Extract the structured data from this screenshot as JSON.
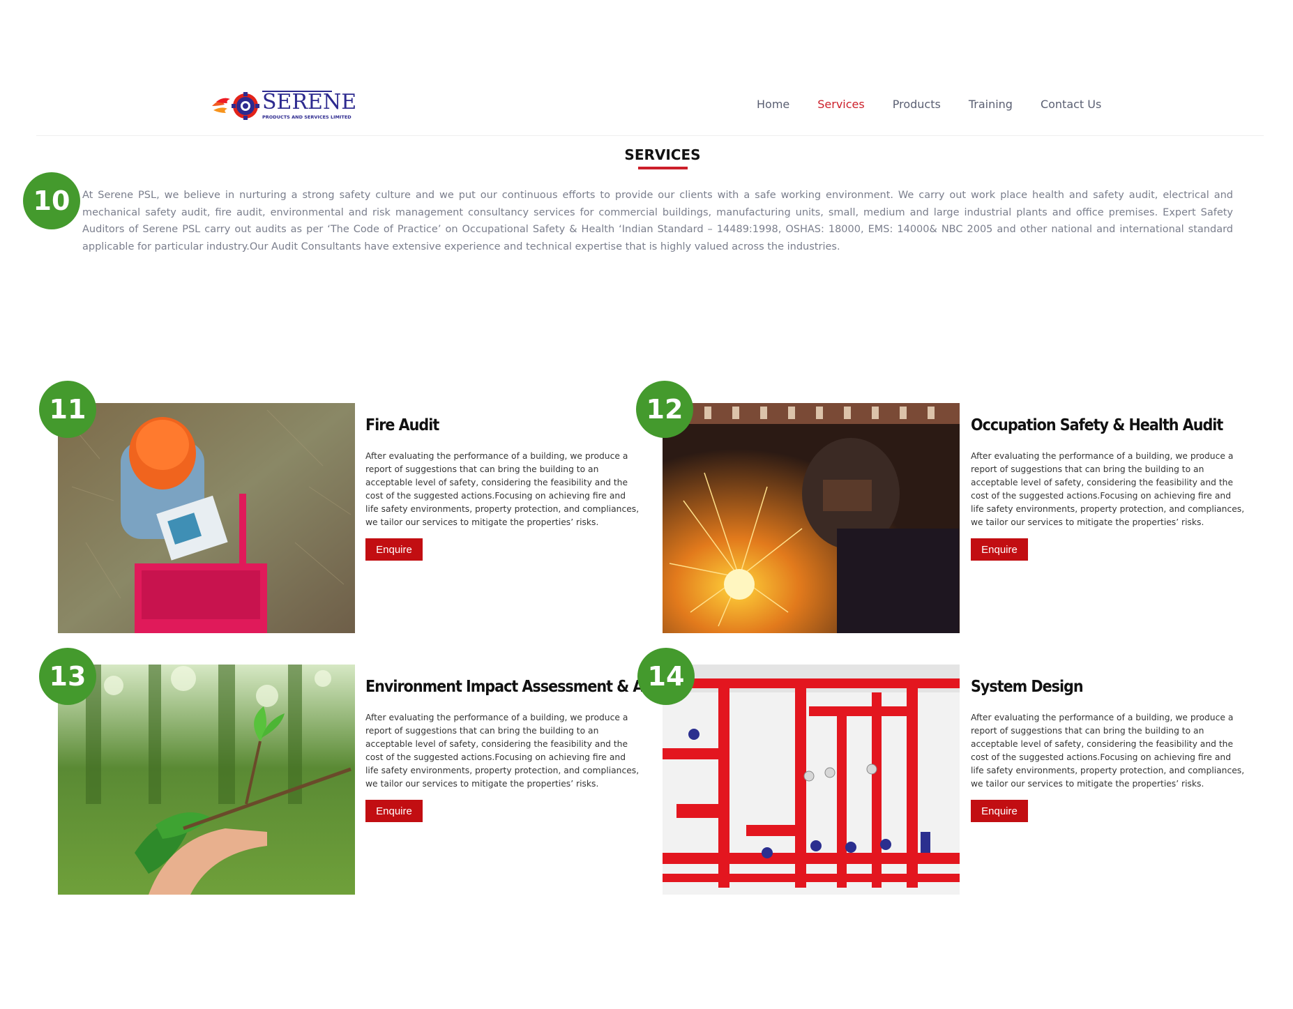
{
  "brand": {
    "name": "SERENE",
    "tagline": "PRODUCTS AND SERVICES LIMITED"
  },
  "nav": {
    "items": [
      {
        "label": "Home",
        "active": false
      },
      {
        "label": "Services",
        "active": true
      },
      {
        "label": "Products",
        "active": false
      },
      {
        "label": "Training",
        "active": false
      },
      {
        "label": "Contact Us",
        "active": false
      }
    ]
  },
  "section": {
    "title": "SERVICES",
    "badge": "10",
    "intro": "At Serene PSL, we believe in nurturing a strong safety culture and we put our continuous efforts to provide our clients with a safe working environment. We carry out work place health and safety audit, electrical and mechanical safety audit, fire audit, environmental and risk management consultancy services for commercial buildings, manufacturing units, small, medium and large industrial plants and office premises. Expert Safety Auditors of Serene PSL carry out audits as per ‘The Code of Practice’ on Occupational Safety & Health ‘Indian Standard – 14489:1998, OSHAS: 18000, EMS: 14000& NBC 2005 and other national and international standard applicable for particular industry.Our Audit Consultants have extensive experience and technical expertise that is highly valued across the industries."
  },
  "services": [
    {
      "badge": "11",
      "title": "Fire Audit",
      "description": "After evaluating the performance of a building, we produce a report of suggestions that can bring the building to an acceptable level of safety, considering the feasibility and the cost of the suggested actions.Focusing on achieving fire and life safety environments, property protection, and compliances, we tailor our services to mitigate the properties’ risks.",
      "button": "Enquire"
    },
    {
      "badge": "12",
      "title": "Occupation Safety & Health Audit",
      "description": "After evaluating the performance of a building, we produce a report of suggestions that can bring the building to an acceptable level of safety, considering the feasibility and the cost of the suggested actions.Focusing on achieving fire and life safety environments, property protection, and compliances, we tailor our services to mitigate the properties’ risks.",
      "button": "Enquire"
    },
    {
      "badge": "13",
      "title": "Environment Impact Assessment & Audit",
      "description": "After evaluating the performance of a building, we produce a report of suggestions that can bring the building to an acceptable level of safety, considering the feasibility and the cost of the suggested actions.Focusing on achieving fire and life safety environments, property protection, and compliances, we tailor our services to mitigate the properties’ risks.",
      "button": "Enquire"
    },
    {
      "badge": "14",
      "title": "System Design",
      "description": "After evaluating the performance of a building, we produce a report of suggestions that can bring the building to an acceptable level of safety, considering the feasibility and the cost of the suggested actions.Focusing on achieving fire and life safety environments, property protection, and compliances, we tailor our services to mitigate the properties’ risks.",
      "button": "Enquire"
    }
  ],
  "colors": {
    "accent": "#cc1f2a",
    "button": "#c20e12",
    "badge": "#449a2d",
    "brand_blue": "#2d2a8f"
  }
}
